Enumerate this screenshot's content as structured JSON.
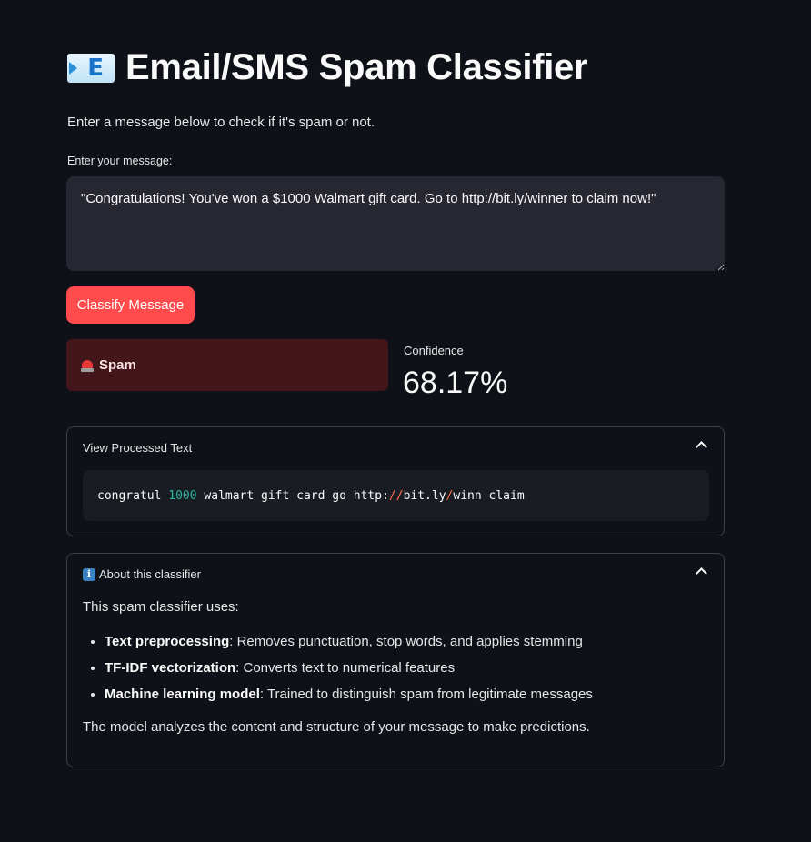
{
  "app": {
    "title": "Email/SMS Spam Classifier",
    "title_icon": "incoming-envelope-icon",
    "subtitle": "Enter a message below to check if it's spam or not."
  },
  "input": {
    "label": "Enter your message:",
    "value": "\"Congratulations! You've won a $1000 Walmart gift card. Go to http://bit.ly/winner to claim now!\""
  },
  "classify_button": {
    "label": "Classify Message"
  },
  "result": {
    "icon": "siren-icon",
    "label": "Spam",
    "colors": {
      "background": "#4a2227",
      "accent": "#ff4b4b"
    }
  },
  "confidence": {
    "label": "Confidence",
    "value": "68.17%"
  },
  "processed_text": {
    "header": "View Processed Text",
    "tokens": [
      {
        "text": "congratul ",
        "kind": "plain"
      },
      {
        "text": "1000",
        "kind": "number"
      },
      {
        "text": " walmart gift card go http:",
        "kind": "plain"
      },
      {
        "text": "//",
        "kind": "sep"
      },
      {
        "text": "bit.ly",
        "kind": "plain"
      },
      {
        "text": "/",
        "kind": "sep"
      },
      {
        "text": "winn claim",
        "kind": "plain"
      }
    ]
  },
  "about": {
    "header": "About this classifier",
    "header_icon": "information-icon",
    "intro": "This spam classifier uses:",
    "items": [
      {
        "bold": "Text preprocessing",
        "text": ": Removes punctuation, stop words, and applies stemming"
      },
      {
        "bold": "TF-IDF vectorization",
        "text": ": Converts text to numerical features"
      },
      {
        "bold": "Machine learning model",
        "text": ": Trained to distinguish spam from legitimate messages"
      }
    ],
    "footer": "The model analyzes the content and structure of your message to make predictions."
  },
  "colors": {
    "background": "#0e1117",
    "primary_button": "#ff4b4b",
    "input_background": "#262730",
    "code_background": "#1a1c24",
    "number_token": "#2cb5a0",
    "separator_token": "#ff6c47"
  }
}
